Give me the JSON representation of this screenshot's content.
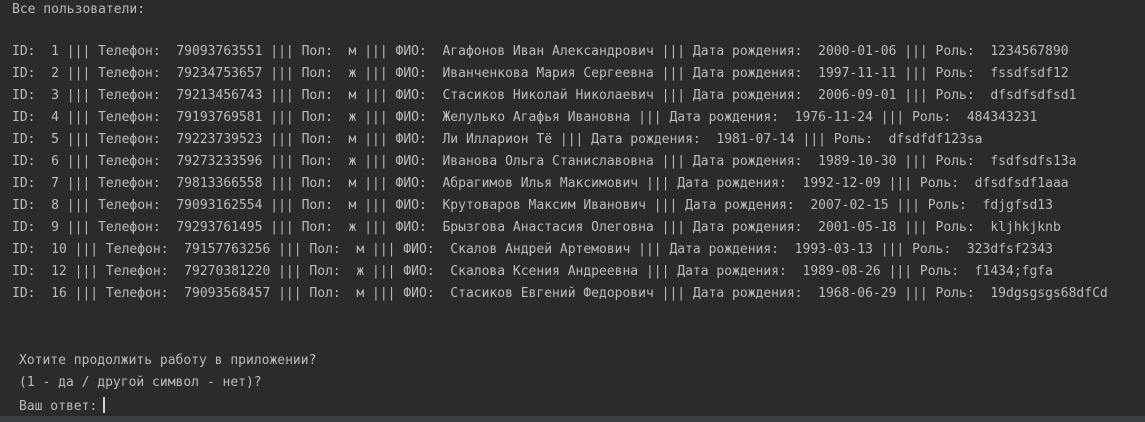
{
  "console": {
    "header": "Все пользователи:",
    "rows": [
      "ID:  1 ||| Телефон:  79093763551 ||| Пол:  м ||| ФИО:  Агафонов Иван Александрович ||| Дата рождения:  2000-01-06 ||| Роль:  1234567890",
      "ID:  2 ||| Телефон:  79234753657 ||| Пол:  ж ||| ФИО:  Иванченкова Мария Сергеевна ||| Дата рождения:  1997-11-11 ||| Роль:  fssdfsdf12",
      "ID:  3 ||| Телефон:  79213456743 ||| Пол:  м ||| ФИО:  Стасиков Николай Николаевич ||| Дата рождения:  2006-09-01 ||| Роль:  dfsdfsdfsd1",
      "ID:  4 ||| Телефон:  79193769581 ||| Пол:  ж ||| ФИО:  Желулько Агафья Ивановна ||| Дата рождения:  1976-11-24 ||| Роль:  484343231",
      "ID:  5 ||| Телефон:  79223739523 ||| Пол:  м ||| ФИО:  Ли Илларион Тё ||| Дата рождения:  1981-07-14 ||| Роль:  dfsdfdf123sa",
      "ID:  6 ||| Телефон:  79273233596 ||| Пол:  ж ||| ФИО:  Иванова Ольга Станиславовна ||| Дата рождения:  1989-10-30 ||| Роль:  fsdfsdfs13a",
      "ID:  7 ||| Телефон:  79813366558 ||| Пол:  м ||| ФИО:  Абрагимов Илья Максимович ||| Дата рождения:  1992-12-09 ||| Роль:  dfsdfsdf1aaa",
      "ID:  8 ||| Телефон:  79093162554 ||| Пол:  м ||| ФИО:  Крутоваров Максим Иванович ||| Дата рождения:  2007-02-15 ||| Роль:  fdjgfsd13",
      "ID:  9 ||| Телефон:  79293761495 ||| Пол:  ж ||| ФИО:  Брызгова Анастасия Олеговна ||| Дата рождения:  2001-05-18 ||| Роль:  kljhkjknb",
      "ID:  10 ||| Телефон:  79157763256 ||| Пол:  м ||| ФИО:  Скалов Андрей Артемович ||| Дата рождения:  1993-03-13 ||| Роль:  323dfsf2343",
      "ID:  12 ||| Телефон:  79270381220 ||| Пол:  ж ||| ФИО:  Скалова Ксения Андреевна ||| Дата рождения:  1989-08-26 ||| Роль:  f1434;fgfa",
      "ID:  16 ||| Телефон:  79093568457 ||| Пол:  м ||| ФИО:  Стасиков Евгений Федорович ||| Дата рождения:  1968-06-29 ||| Роль:  19dgsgsgs68dfCd"
    ],
    "prompt_question": "Хотите продолжить работу в приложении?",
    "prompt_options": "(1 - да / другой символ - нет)?",
    "prompt_answer_label": "Ваш ответ:",
    "answer_value": ""
  },
  "colors": {
    "background": "#2b2b2b",
    "text": "#bbbbbb",
    "bottom_bar": "#3c3f41"
  }
}
